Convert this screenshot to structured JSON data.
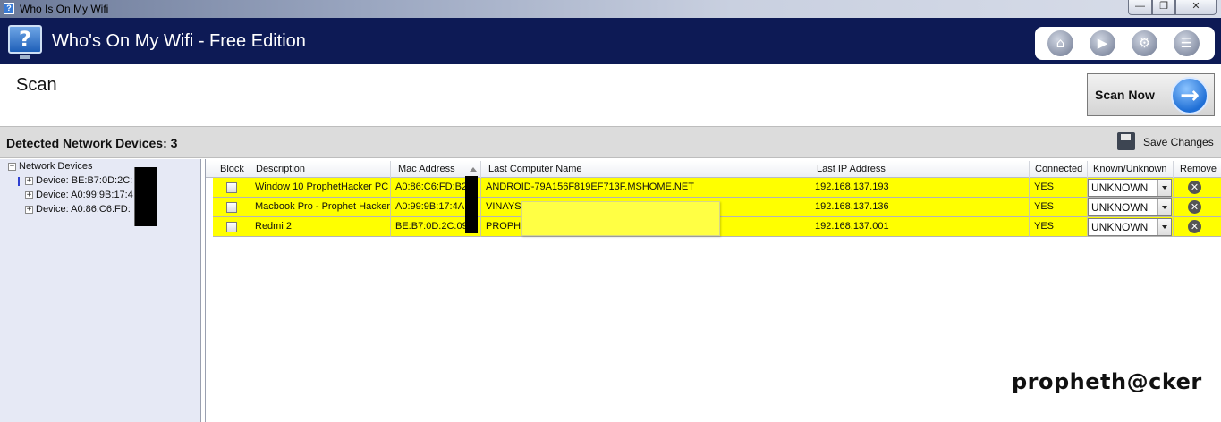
{
  "window": {
    "title": "Who Is On My Wifi",
    "minimize_glyph": "—",
    "maximize_glyph": "❐",
    "close_glyph": "✕"
  },
  "header": {
    "logo_glyph": "?",
    "app_title": "Who's On My Wifi - Free Edition",
    "tools": [
      {
        "icon": "home-icon",
        "glyph": "⌂"
      },
      {
        "icon": "play-icon",
        "glyph": "▶"
      },
      {
        "icon": "gear-icon",
        "glyph": "⚙"
      },
      {
        "icon": "document-icon",
        "glyph": "☰"
      }
    ]
  },
  "scan": {
    "title": "Scan",
    "button_label": "Scan Now",
    "arrow_glyph": "→"
  },
  "detected": {
    "label": "Detected Network Devices: 3",
    "save_label": "Save Changes"
  },
  "tree": {
    "root": "Network Devices",
    "root_toggle": "−",
    "child_toggle": "+",
    "items": [
      "Device: BE:B7:0D:2C:",
      "Device: A0:99:9B:17:4",
      "Device: A0:86:C6:FD:"
    ]
  },
  "grid": {
    "columns": [
      "Block",
      "Description",
      "Mac Address",
      "Last Computer Name",
      "Last IP Address",
      "Connected",
      "Known/Unknown",
      "Remove"
    ],
    "rows": [
      {
        "description": "Window 10 ProphetHacker PC",
        "mac": "A0:86:C6:FD:B2",
        "name": "ANDROID-79A156F819EF713F.MSHOME.NET",
        "ip": "192.168.137.193",
        "connected": "YES",
        "status": "UNKNOWN"
      },
      {
        "description": "Macbook Pro - Prophet Hacker",
        "mac": "A0:99:9B:17:4A:",
        "name": "VINAYS-",
        "ip": "192.168.137.136",
        "connected": "YES",
        "status": "UNKNOWN"
      },
      {
        "description": "Redmi 2",
        "mac": "BE:B7:0D:2C:09",
        "name": "PROPHE",
        "ip": "192.168.137.001",
        "connected": "YES",
        "status": "UNKNOWN"
      }
    ],
    "remove_glyph": "✕"
  },
  "watermark": "propheth@cker",
  "colors": {
    "header_bg": "#0d1a55",
    "row_highlight": "#ffff00",
    "tree_bg": "#e6e9f5"
  }
}
